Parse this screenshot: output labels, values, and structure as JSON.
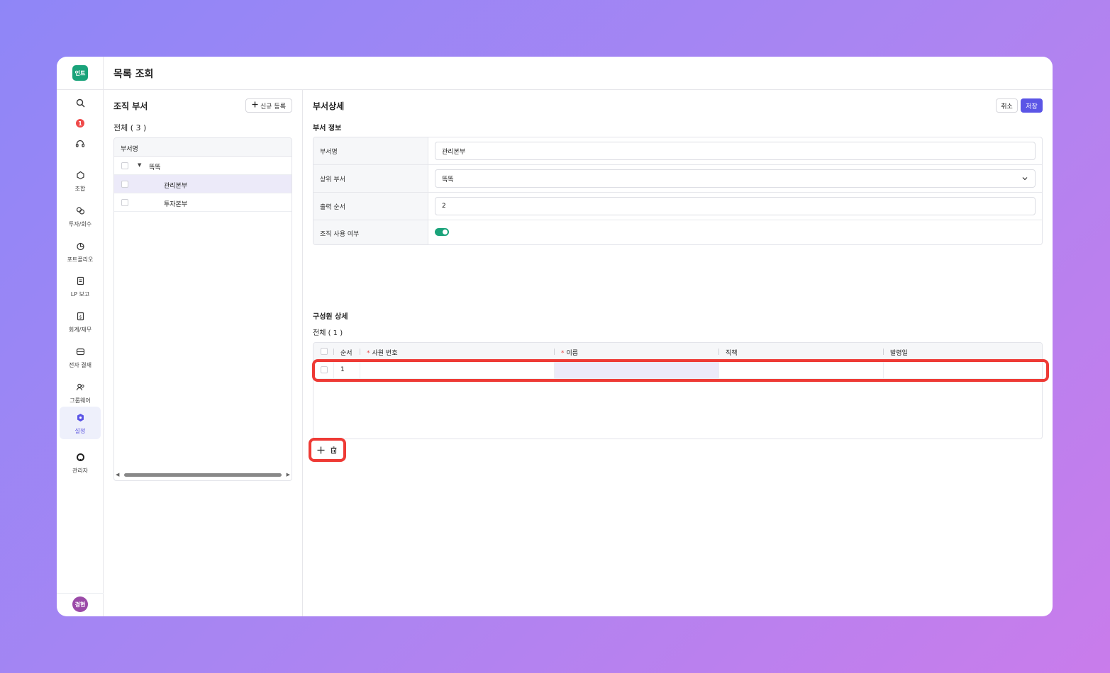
{
  "app": {
    "logo_text": "언트",
    "notification_count": "1",
    "avatar_text": "경현"
  },
  "topbar": {
    "title": "목록 조회"
  },
  "nav": [
    {
      "label": "조합",
      "icon": "union-icon"
    },
    {
      "label": "투자/회수",
      "icon": "investment-icon"
    },
    {
      "label": "포트폴리오",
      "icon": "portfolio-icon"
    },
    {
      "label": "LP 보고",
      "icon": "report-icon"
    },
    {
      "label": "회계/재무",
      "icon": "accounting-icon"
    },
    {
      "label": "전자 결재",
      "icon": "approval-icon"
    },
    {
      "label": "그룹웨어",
      "icon": "groupware-icon"
    },
    {
      "label": "설정",
      "icon": "settings-icon",
      "active": true
    },
    {
      "label": "관리자",
      "icon": "admin-icon"
    }
  ],
  "left_panel": {
    "title": "조직 부서",
    "new_button": "신규 등록",
    "count_label": "전체 ( 3 )",
    "column_header": "부서명",
    "tree": [
      {
        "label": "똑똑",
        "level": 0,
        "expanded": true
      },
      {
        "label": "관리본부",
        "level": 1,
        "selected": true
      },
      {
        "label": "투자본부",
        "level": 1
      }
    ]
  },
  "detail": {
    "title": "부서상세",
    "cancel_label": "취소",
    "save_label": "저장",
    "info_section": "부서 정보",
    "fields": {
      "name_label": "부서명",
      "name_value": "관리본부",
      "parent_label": "상위 부서",
      "parent_value": "똑똑",
      "order_label": "출력 순서",
      "order_value": "2",
      "active_label": "조직 사용 여부",
      "active_value": true
    },
    "members_section": "구성원 상세",
    "members_count": "전체 ( 1 )",
    "columns": {
      "order": "순서",
      "emp_no": "사원 번호",
      "name": "이름",
      "position": "직책",
      "date": "발령일"
    },
    "rows": [
      {
        "order": "1",
        "emp_no": "",
        "name": "",
        "position": "",
        "date": ""
      }
    ]
  },
  "colors": {
    "accent": "#5b55e6",
    "brand": "#1aa37a",
    "highlight": "#ee3a35"
  }
}
